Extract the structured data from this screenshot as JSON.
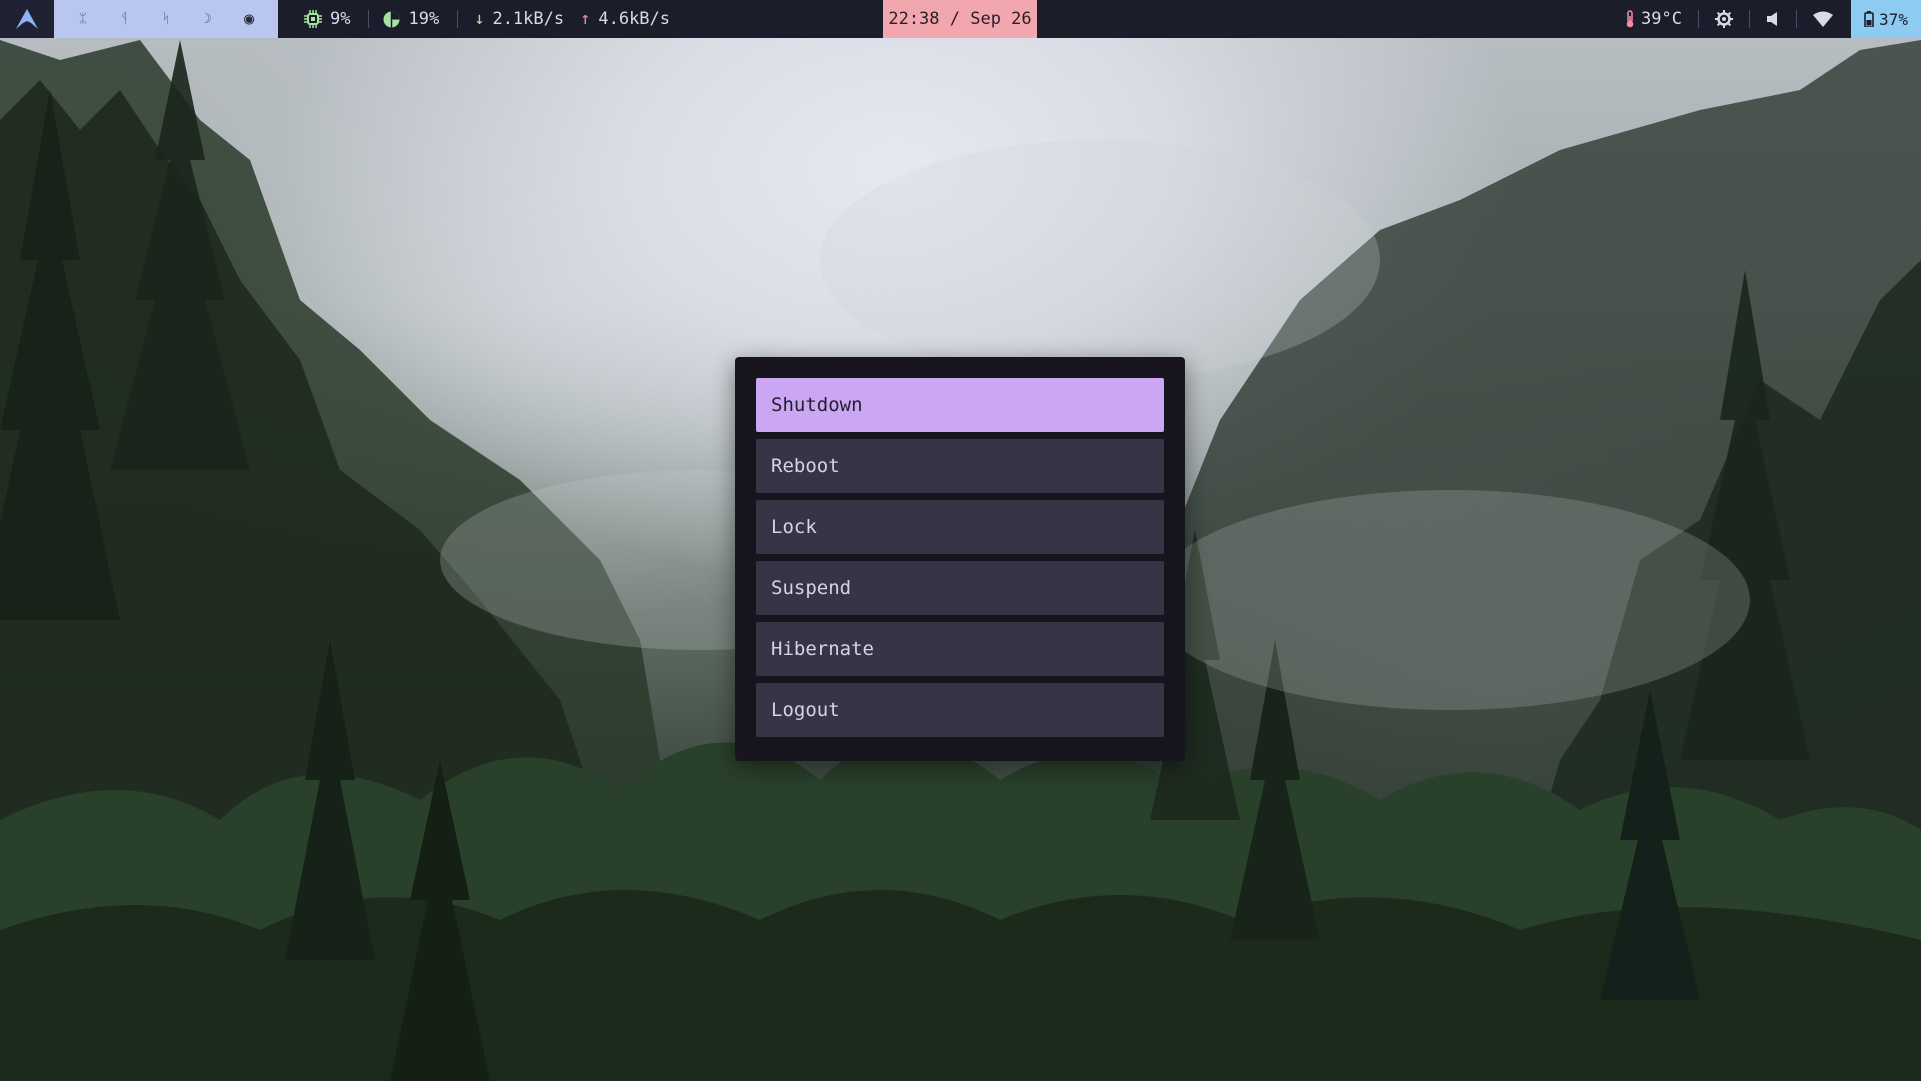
{
  "topbar": {
    "logo_icon": "arch-linux-icon",
    "workspaces": [
      {
        "glyph": "ᛯ",
        "icon": "workspace-1-icon"
      },
      {
        "glyph": "ᛩ",
        "icon": "workspace-2-icon"
      },
      {
        "glyph": "ᛋ",
        "icon": "workspace-3-icon"
      },
      {
        "glyph": "☽",
        "icon": "workspace-moon-icon"
      },
      {
        "glyph": "◉",
        "icon": "workspace-active-icon"
      }
    ],
    "cpu": {
      "icon": "cpu-icon",
      "value": "9%"
    },
    "memory": {
      "icon": "memory-pie-icon",
      "value": "19%"
    },
    "net_down": {
      "icon": "arrow-down-icon",
      "value": "2.1kB/s"
    },
    "net_up": {
      "icon": "arrow-up-icon",
      "value": "4.6kB/s"
    },
    "clock": "22:38 / Sep 26",
    "temperature": {
      "icon": "thermometer-icon",
      "value": "39°C"
    },
    "battery": {
      "icon": "battery-icon",
      "value": "37%"
    },
    "colors": {
      "bar_bg": "#1c1d2a",
      "workspaces_bg": "#b9c6ef",
      "clock_bg": "#f2a7ae",
      "battery_bg": "#8ecbf2",
      "cpu_accent": "#a6e3a1",
      "down_accent": "#a6e3a1",
      "up_accent": "#f38ba8"
    }
  },
  "power_menu": {
    "items": [
      {
        "label": "Shutdown",
        "active": true
      },
      {
        "label": "Reboot",
        "active": false
      },
      {
        "label": "Lock",
        "active": false
      },
      {
        "label": "Suspend",
        "active": false
      },
      {
        "label": "Hibernate",
        "active": false
      },
      {
        "label": "Logout",
        "active": false
      }
    ],
    "colors": {
      "panel_bg": "#17161f",
      "item_bg": "#363546",
      "active_bg": "#cba6f2"
    }
  }
}
